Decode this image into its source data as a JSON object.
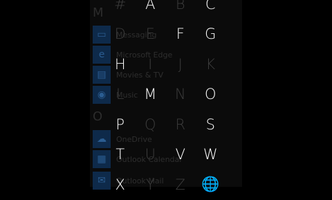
{
  "app_list": {
    "section_letters": [
      "M",
      "O"
    ],
    "items": [
      {
        "label": "Messaging",
        "icon": "message-icon"
      },
      {
        "label": "Microsoft Edge",
        "icon": "edge-icon"
      },
      {
        "label": "Movies & TV",
        "icon": "movies-icon"
      },
      {
        "label": "Music",
        "icon": "music-icon"
      },
      {
        "label": "OneDrive",
        "icon": "cloud-icon"
      },
      {
        "label": "Outlook Calendar",
        "icon": "calendar-icon"
      },
      {
        "label": "Outlook Mail",
        "icon": "mail-icon"
      }
    ]
  },
  "jump_list": {
    "cells": [
      {
        "label": "#",
        "active": false
      },
      {
        "label": "A",
        "active": true
      },
      {
        "label": "B",
        "active": false
      },
      {
        "label": "C",
        "active": true
      },
      {
        "label": "D",
        "active": false
      },
      {
        "label": "E",
        "active": false
      },
      {
        "label": "F",
        "active": true
      },
      {
        "label": "G",
        "active": true
      },
      {
        "label": "H",
        "active": true
      },
      {
        "label": "I",
        "active": false
      },
      {
        "label": "J",
        "active": false
      },
      {
        "label": "K",
        "active": false
      },
      {
        "label": "L",
        "active": false
      },
      {
        "label": "M",
        "active": true
      },
      {
        "label": "N",
        "active": false
      },
      {
        "label": "O",
        "active": true
      },
      {
        "label": "P",
        "active": true
      },
      {
        "label": "Q",
        "active": false
      },
      {
        "label": "R",
        "active": false
      },
      {
        "label": "S",
        "active": true
      },
      {
        "label": "T",
        "active": true
      },
      {
        "label": "U",
        "active": false
      },
      {
        "label": "V",
        "active": true
      },
      {
        "label": "W",
        "active": true
      },
      {
        "label": "X",
        "active": true
      },
      {
        "label": "Y",
        "active": false
      },
      {
        "label": "Z",
        "active": false
      },
      {
        "label": "🌐",
        "active": false
      }
    ]
  }
}
